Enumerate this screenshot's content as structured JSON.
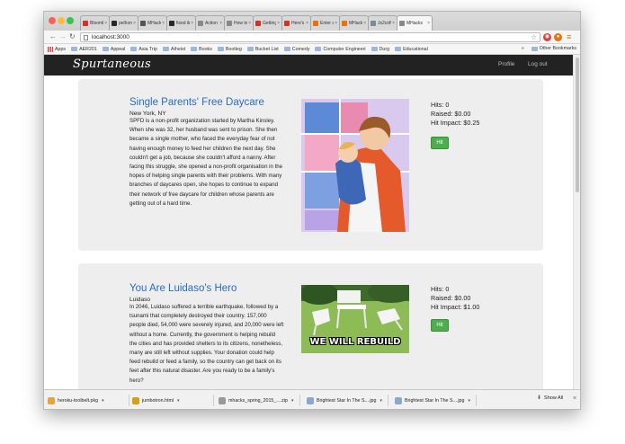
{
  "browser": {
    "tabs": [
      {
        "label": "Bloomb",
        "color": "#d93025"
      },
      {
        "label": "pelhong",
        "color": "#24292e"
      },
      {
        "label": "MHacks",
        "color": "#555555"
      },
      {
        "label": "fixed ilm",
        "color": "#24292e"
      },
      {
        "label": "Action C",
        "color": "#888888"
      },
      {
        "label": "How to",
        "color": "#888888"
      },
      {
        "label": "Getting",
        "color": "#d93025"
      },
      {
        "label": "Here's I",
        "color": "#d93025"
      },
      {
        "label": "Enter a I",
        "color": "#e8710a"
      },
      {
        "label": "MHacks",
        "color": "#e8710a"
      },
      {
        "label": "Js2coffe",
        "color": "#7a8a99"
      },
      {
        "label": "MHacks",
        "color": "#888888",
        "active": true
      }
    ],
    "url": "localhost:3000",
    "bookmarks": [
      "AER201",
      "Appeal",
      "Asia Trip",
      "Atheist",
      "Books",
      "Bootleg",
      "Bucket List",
      "Comedy",
      "Computer Engineeri",
      "Durg",
      "Educational"
    ],
    "apps_label": "Apps",
    "other_bookmarks": "Other Bookmarks",
    "overflow_label": "»"
  },
  "site": {
    "brand": "Spurtaneous",
    "nav": {
      "profile": "Profile",
      "logout": "Log out"
    }
  },
  "cards": [
    {
      "title": "Single Parents' Free Daycare",
      "location": "New York, NY",
      "description": "SPFD is a non-profit organization started by Martha Kinsley. When she was 32, her husband was sent to prison. She then became a single mother, who faced the everyday fear of not having enough money to feed her children the next day. She couldn't get a job, because she couldn't afford a nanny. After facing this struggle, she opened a non-profit organisation in the hopes of helping single parents with their problems. With many branches of daycares open, she hopes to continue to expand their network of free daycare for children whose parents are getting out of a hard time.",
      "hits": "Hits: 0",
      "raised": "Raised: $0.00",
      "impact": "Hit Impact: $0.25",
      "button": "Hit",
      "image": "parent-holding-child-illustration"
    },
    {
      "title": "You Are Luidaso's Hero",
      "location": "Luidaso",
      "description": "In 2046, Luidaso suffered a terrible earthquake, followed by a tsunami that completely destroyed their country. 157,000 people died, 54,000 were severely injured, and 20,000 were left without a home. Currently, the government is helping rebuild the cities and has provided shelters to its citizens, nonetheless, many are still left without supplies. Your donation could help feed rebuild or feed a family, so the country can get back on its feet after this natural disaster. Are you ready to be a family's hero?",
      "hits": "Hits: 0",
      "raised": "Raised: $0.00",
      "impact": "Hit Impact: $1.00",
      "button": "Hit",
      "image": "fallen-lawn-chairs-meme",
      "image_caption": "WE WILL REBUILD"
    }
  ],
  "downloads": [
    {
      "name": "heroku-toolbelt.pkg",
      "color": "#e8a33d"
    },
    {
      "name": "jumbotron.html",
      "color": "#d4a017"
    },
    {
      "name": "mhacks_spring_2015_....zip",
      "color": "#999999"
    },
    {
      "name": "Brightest Star In The S....jpg",
      "color": "#8aa8c8"
    },
    {
      "name": "Brightest Star In The S....jpg",
      "color": "#8aa8c8"
    }
  ],
  "shelf": {
    "show_all": "Show All",
    "close": "×"
  }
}
